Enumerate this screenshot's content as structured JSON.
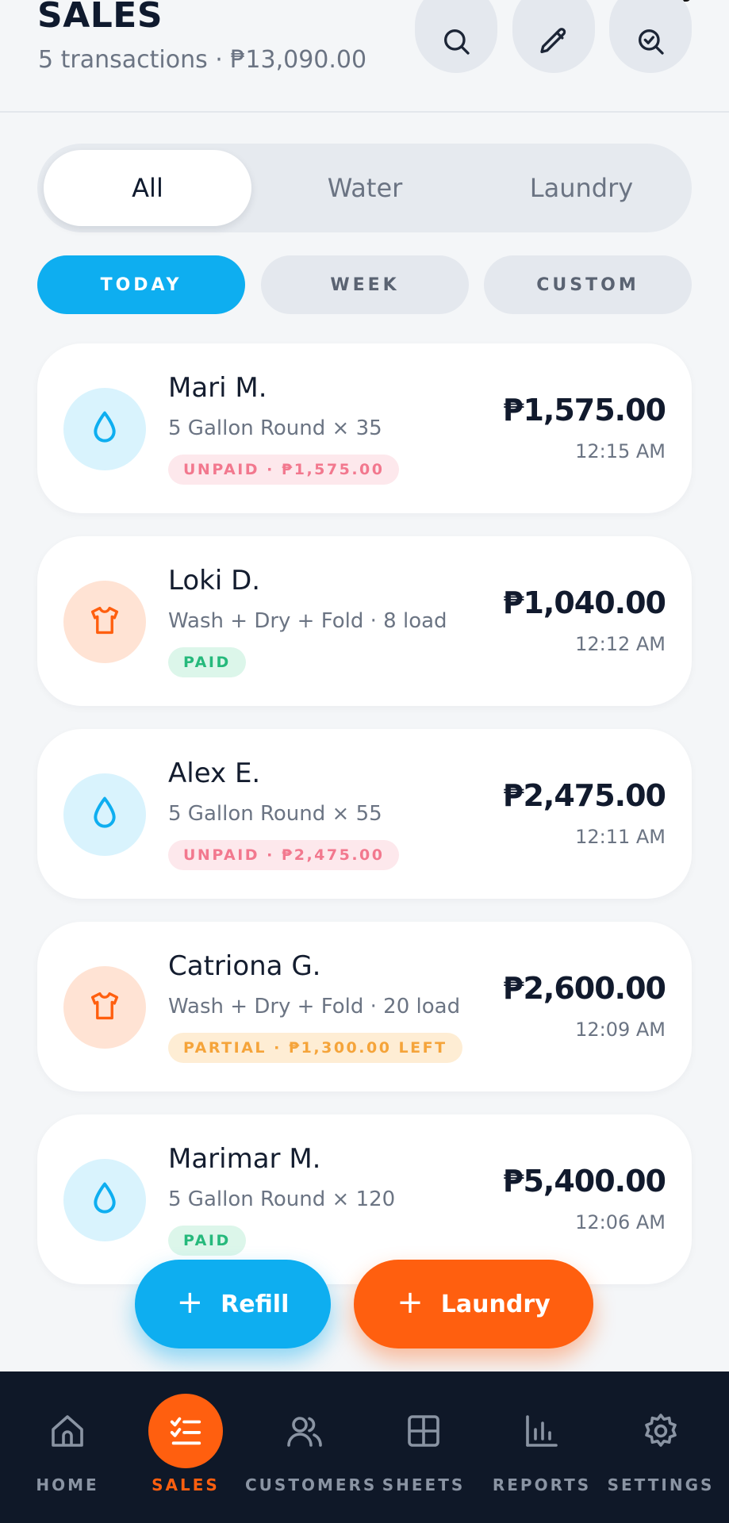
{
  "header": {
    "title": "SALES",
    "subtitle": "5 transactions · ₱13,090.00"
  },
  "category_tabs": [
    {
      "label": "All",
      "active": true
    },
    {
      "label": "Water",
      "active": false
    },
    {
      "label": "Laundry",
      "active": false
    }
  ],
  "period_filters": [
    {
      "label": "TODAY",
      "active": true
    },
    {
      "label": "WEEK",
      "active": false
    },
    {
      "label": "CUSTOM",
      "active": false
    }
  ],
  "transactions": [
    {
      "name": "Mari M.",
      "detail": "5 Gallon Round × 35",
      "status": "UNPAID · ₱1,575.00",
      "status_type": "unpaid",
      "amount": "₱1,575.00",
      "time": "12:15 AM",
      "icon": "water-drop-icon"
    },
    {
      "name": "Loki D.",
      "detail": "Wash + Dry + Fold · 8 load",
      "status": "PAID",
      "status_type": "paid",
      "amount": "₱1,040.00",
      "time": "12:12 AM",
      "icon": "shirt-icon"
    },
    {
      "name": "Alex E.",
      "detail": "5 Gallon Round × 55",
      "status": "UNPAID · ₱2,475.00",
      "status_type": "unpaid",
      "amount": "₱2,475.00",
      "time": "12:11 AM",
      "icon": "water-drop-icon"
    },
    {
      "name": "Catriona G.",
      "detail": "Wash + Dry + Fold · 20 load",
      "status": "PARTIAL · ₱1,300.00 LEFT",
      "status_type": "partial",
      "amount": "₱2,600.00",
      "time": "12:09 AM",
      "icon": "shirt-icon"
    },
    {
      "name": "Marimar M.",
      "detail": "5 Gallon Round × 120",
      "status": "PAID",
      "status_type": "paid",
      "amount": "₱5,400.00",
      "time": "12:06 AM",
      "icon": "water-drop-icon"
    }
  ],
  "fabs": {
    "refill_label": "Refill",
    "laundry_label": "Laundry",
    "plus": "+"
  },
  "nav": [
    {
      "label": "HOME",
      "icon": "home-icon",
      "active": false
    },
    {
      "label": "SALES",
      "icon": "checklist-icon",
      "active": true
    },
    {
      "label": "CUSTOMERS",
      "icon": "users-icon",
      "active": false
    },
    {
      "label": "SHEETS",
      "icon": "grid-icon",
      "active": false
    },
    {
      "label": "REPORTS",
      "icon": "bar-chart-icon",
      "active": false
    },
    {
      "label": "SETTINGS",
      "icon": "gear-icon",
      "active": false
    }
  ],
  "colors": {
    "water_accent": "#0eaef0",
    "laundry_accent": "#ff5f0f",
    "nav_background": "#0f1828"
  }
}
